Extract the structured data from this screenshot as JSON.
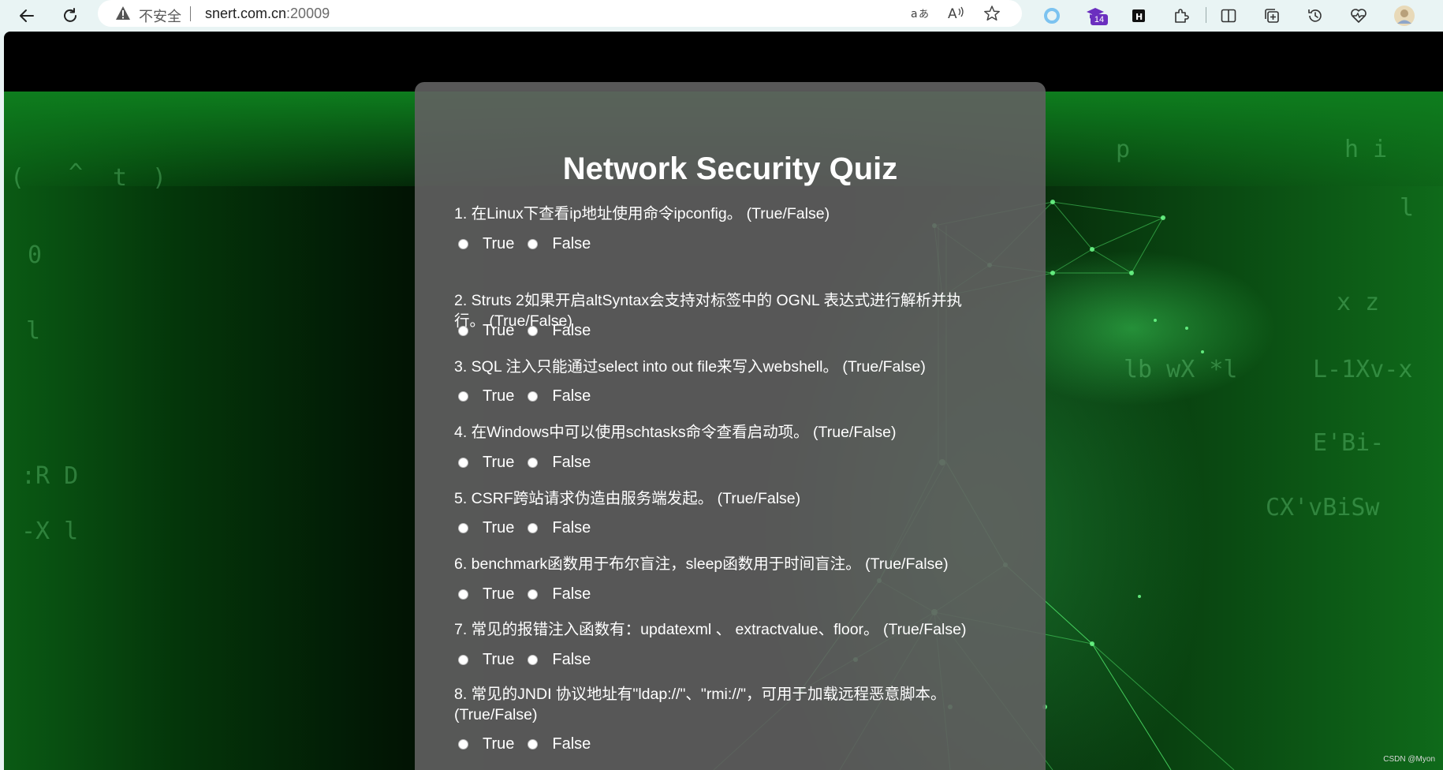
{
  "browser": {
    "security_text": "不安全",
    "url_host": "snert.com.cn",
    "url_port": ":20009",
    "extension_badge": "14"
  },
  "page": {
    "title": "Network Security Quiz",
    "true_label": "True",
    "false_label": "False"
  },
  "questions": [
    {
      "text": "1. 在Linux下查看ip地址使用命令ipconfig。 (True/False)"
    },
    {
      "text": "2. Struts 2如果开启altSyntax会支持对标签中的 OGNL 表达式进行解析并执行。 (True/False)"
    },
    {
      "text": "3. SQL 注入只能通过select into out file来写入webshell。 (True/False)"
    },
    {
      "text": "4. 在Windows中可以使用schtasks命令查看启动项。 (True/False)"
    },
    {
      "text": "5. CSRF跨站请求伪造由服务端发起。 (True/False)"
    },
    {
      "text": "6. benchmark函数用于布尔盲注，sleep函数用于时间盲注。 (True/False)"
    },
    {
      "text": "7. 常见的报错注入函数有：updatexml 、 extractvalue、floor。 (True/False)"
    },
    {
      "text": "8. 常见的JNDI 协议地址有\"ldap://\"、\"rmi://\"，可用于加载远程恶意脚本。 (True/False)"
    }
  ],
  "watermark": "CSDN @Myon⁠",
  "colors": {
    "panel": "#606060",
    "text": "#ffffff",
    "browser_bg": "#e9f4f4",
    "accent_badge": "#6b2fbf"
  }
}
